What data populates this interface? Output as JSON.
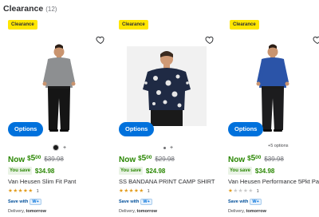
{
  "header": {
    "title": "Clearance",
    "count": "(12)"
  },
  "colors": {
    "accent_blue": "#0071dc",
    "price_green": "#2a8703",
    "badge_yellow": "#ffe600",
    "star_gold": "#e29a19"
  },
  "products": [
    {
      "badge": "Clearance",
      "image_icon": "man-standing-gray-shirt-black-pants",
      "options_label": "Options",
      "swatch_plus": "+",
      "now_label": "Now",
      "currency": "$",
      "price_int": "5",
      "price_cents": "00",
      "was_price": "$39.98",
      "you_save_label": "You save",
      "save_amount": "$34.98",
      "name": "Van Heusen Slim Fit Pant",
      "rating": 5,
      "review_count": "1",
      "wplus_text": "Save with",
      "wplus_badge": "W+",
      "delivery_label": "Delivery, ",
      "delivery_when": "tomorrow"
    },
    {
      "badge": "Clearance",
      "image_icon": "man-bandana-print-shirt",
      "options_label": "Options",
      "swatch_plus": "+",
      "now_label": "Now",
      "currency": "$",
      "price_int": "5",
      "price_cents": "00",
      "was_price": "$29.98",
      "you_save_label": "You save",
      "save_amount": "$24.98",
      "name": "SS BANDANA PRINT CAMP SHIRT",
      "rating": 5,
      "review_count": "1",
      "wplus_text": "Save with",
      "wplus_badge": "W+",
      "delivery_label": "Delivery, ",
      "delivery_when": "tomorrow"
    },
    {
      "badge": "Clearance",
      "image_icon": "man-standing-blue-shirt-black-pants",
      "options_label": "Options",
      "more_options": "+5 options",
      "now_label": "Now",
      "currency": "$",
      "price_int": "5",
      "price_cents": "00",
      "was_price": "$39.98",
      "you_save_label": "You save",
      "save_amount": "$34.98",
      "name": "Van Heusen Performance 5Pkt Pant",
      "rating": 1,
      "review_count": "1",
      "wplus_text": "Save with",
      "wplus_badge": "W+",
      "delivery_label": "Delivery, ",
      "delivery_when": "tomorrow"
    }
  ]
}
